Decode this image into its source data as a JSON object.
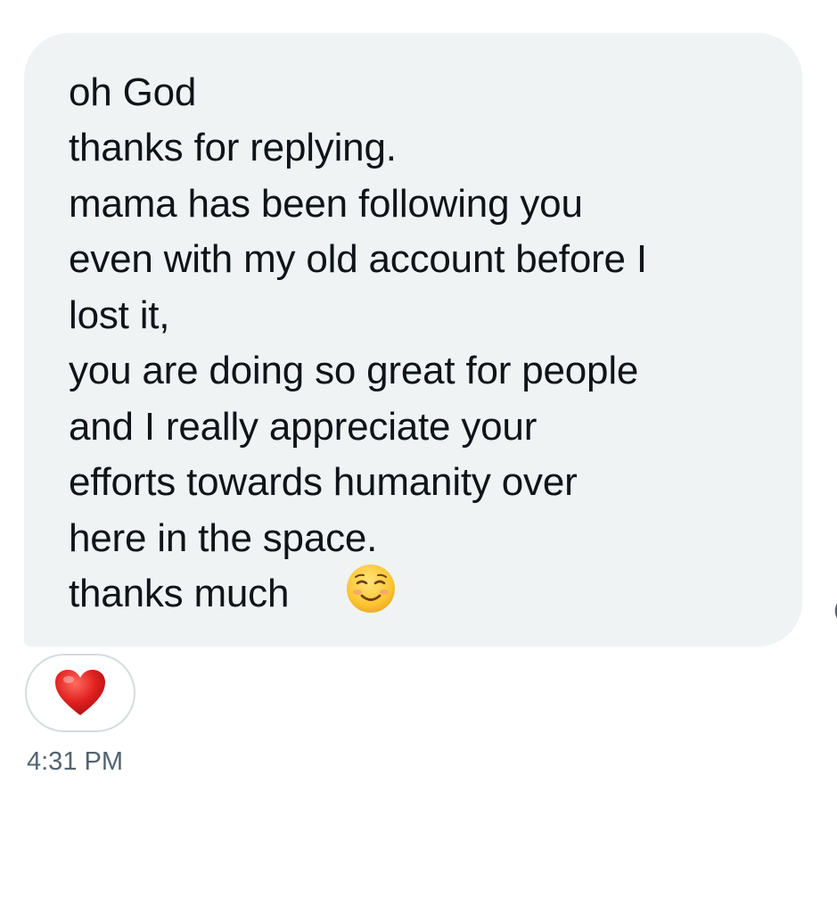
{
  "message": {
    "lines": [
      "oh God",
      "thanks for replying.",
      "mama has been following you",
      "even with my old account before I",
      "lost it,",
      "you are doing so great for people",
      "and I really appreciate your",
      "efforts towards humanity over",
      "here in the space.",
      "thanks much"
    ],
    "trailing_emoji_icon": "smiling-face-icon"
  },
  "reaction": {
    "icon": "red-heart-icon"
  },
  "timestamp": "4:31 PM",
  "colors": {
    "bubble": "#eff3f4",
    "text": "#0f1419",
    "timestamp": "#536471",
    "heart": "#e0201f"
  }
}
